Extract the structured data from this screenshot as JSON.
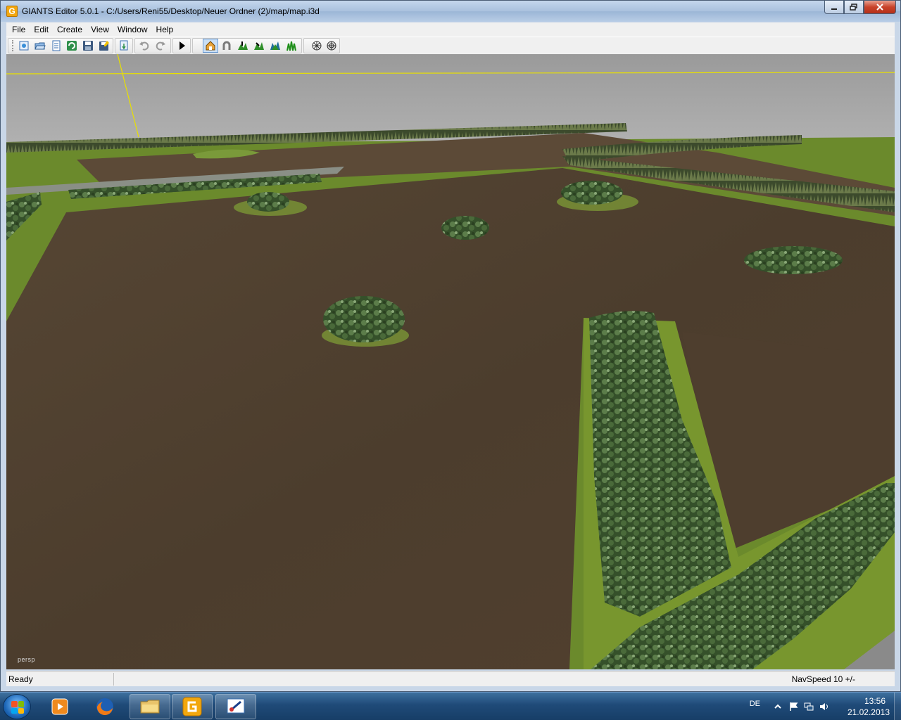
{
  "window": {
    "title": "GIANTS Editor 5.0.1 - C:/Users/Reni55/Desktop/Neuer Ordner (2)/map/map.i3d",
    "app_icon_letter": "G"
  },
  "menubar": {
    "items": [
      "File",
      "Edit",
      "Create",
      "View",
      "Window",
      "Help"
    ]
  },
  "toolbar": {
    "buttons": [
      "new-scene-icon",
      "open-icon",
      "import-icon",
      "reload-icon",
      "save-icon",
      "save-as-icon",
      "export-icon",
      "undo-icon",
      "redo-icon",
      "play-icon",
      "select-mode-icon",
      "magnet-icon",
      "terrain-sculpt-icon",
      "terrain-paint-icon",
      "foliage-icon",
      "grass-icon",
      "debug-render-icon",
      "debug-render-alt-icon"
    ]
  },
  "viewport": {
    "camera_label": "persp",
    "colors": {
      "sky": "#9c9c9c",
      "soil": "#4f4030",
      "grass": "#6f8c2e",
      "trees": "#3d5a2b"
    }
  },
  "statusbar": {
    "status": "Ready",
    "navspeed": "NavSpeed 10 +/-"
  },
  "taskbar": {
    "language": "DE",
    "time": "13:56",
    "date": "21.02.2013"
  }
}
